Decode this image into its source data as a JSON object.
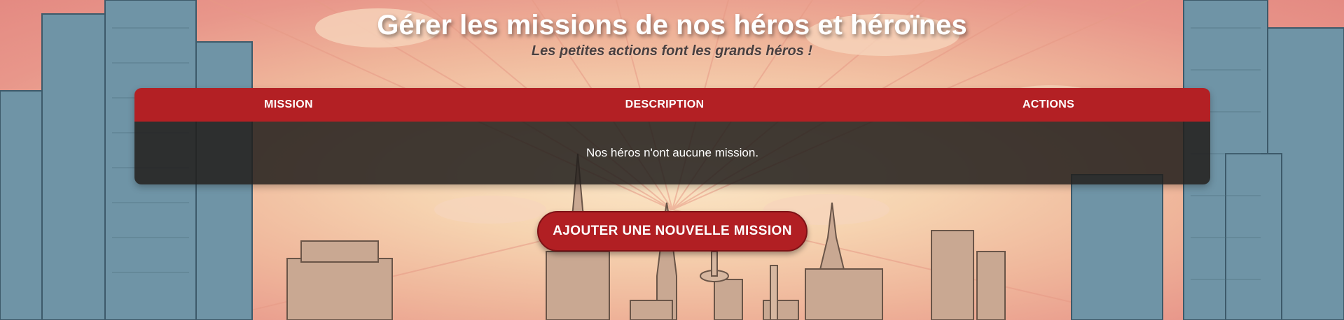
{
  "header": {
    "title": "Gérer les missions de nos héros et héroïnes",
    "subtitle": "Les petites actions font les grands héros !"
  },
  "table": {
    "columns": [
      "MISSION",
      "DESCRIPTION",
      "ACTIONS"
    ],
    "empty_message": "Nos héros n'ont aucune mission."
  },
  "actions": {
    "add_mission_label": "AJOUTER UNE NOUVELLE MISSION"
  },
  "colors": {
    "accent": "#b32024",
    "table_body": "#221e1c",
    "title_text": "#ffffff",
    "subtitle_text": "#4a4040"
  },
  "background": {
    "image_semantic": "comic-city-skyline-background"
  }
}
